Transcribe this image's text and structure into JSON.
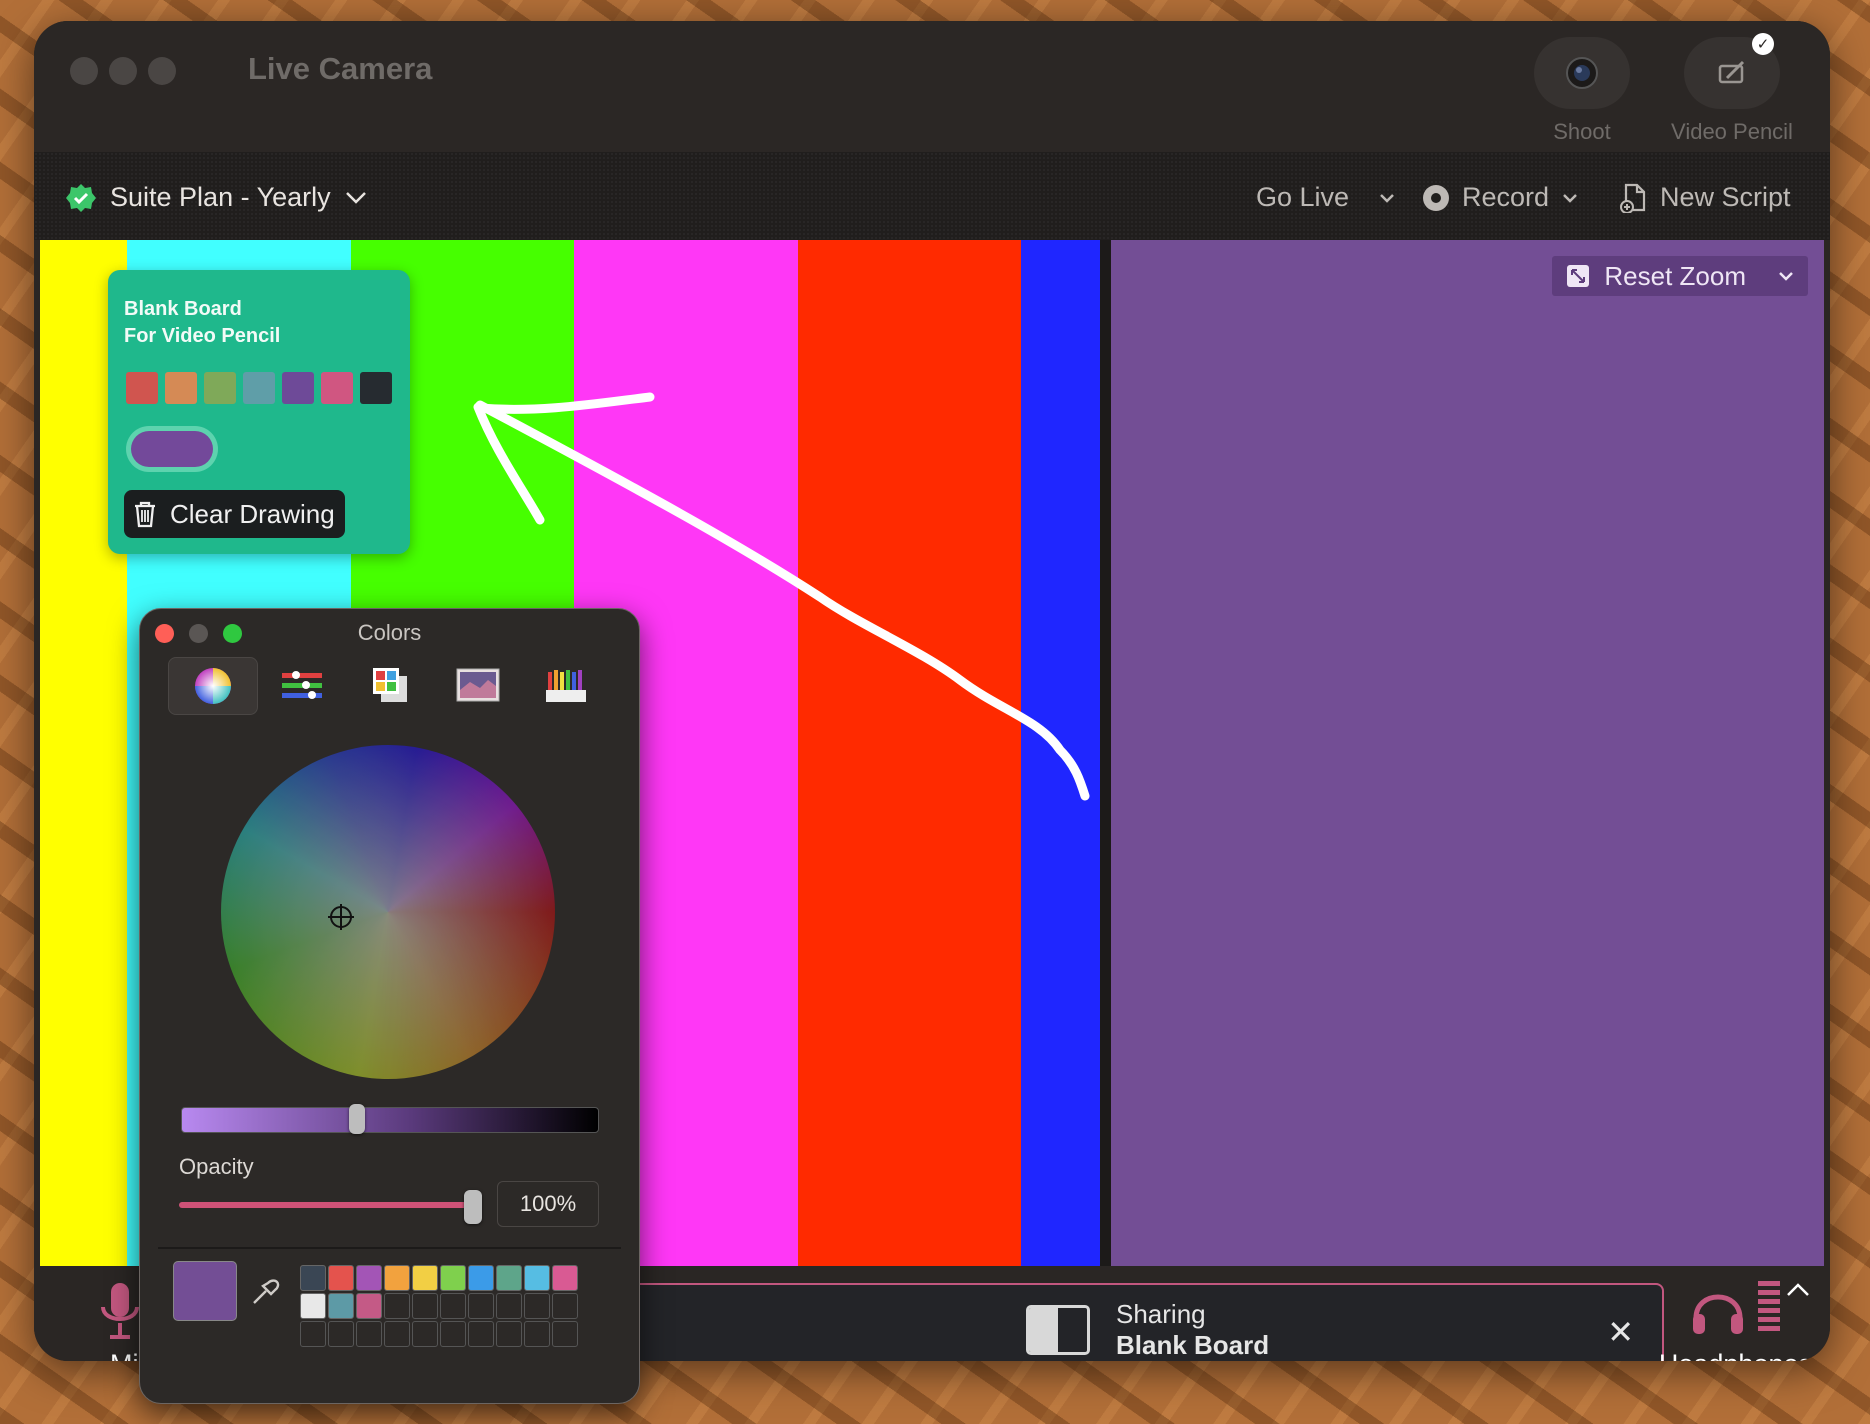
{
  "window": {
    "title": "Live Camera"
  },
  "top_tools": [
    {
      "label": "Shoot",
      "icon": "camera-lens-icon"
    },
    {
      "label": "Video Pencil",
      "icon": "pencil-tablet-icon",
      "badge": "✓"
    }
  ],
  "toolbar": {
    "plan_label": "Suite Plan - Yearly",
    "go_live": "Go Live",
    "record": "Record",
    "new_script": "New Script"
  },
  "stage": {
    "reset_zoom": "Reset Zoom",
    "color_bars": [
      "#ffff00",
      "#41ffff",
      "#46ff00",
      "#ff37f6",
      "#ff2a00",
      "#1f26ff"
    ]
  },
  "pencil_panel": {
    "title_line1": "Blank Board",
    "title_line2": "For Video Pencil",
    "swatches": [
      "#d0554f",
      "#d58a55",
      "#7fa959",
      "#5f9ea8",
      "#6e4a98",
      "#d05681",
      "#262b30"
    ],
    "selected_color": "#73499a",
    "clear_label": "Clear Drawing"
  },
  "colors_panel": {
    "title": "Colors",
    "opacity_label": "Opacity",
    "opacity_value": "100%",
    "current_color": "#734e95",
    "palette_row1": [
      "#3a4654",
      "#e4534d",
      "#a355b6",
      "#f2a23e",
      "#f2cf44",
      "#7fd04d",
      "#3b9be8",
      "#5ea58a",
      "#56bde3",
      "#d95a93"
    ],
    "palette_row2": [
      "#e8e8e8",
      "#5d9aa6",
      "#c45a86"
    ]
  },
  "bottom": {
    "mic_label": "Mi",
    "sharing_label": "Sharing",
    "sharing_target": "Blank Board",
    "headphones_label": "Headphones"
  }
}
